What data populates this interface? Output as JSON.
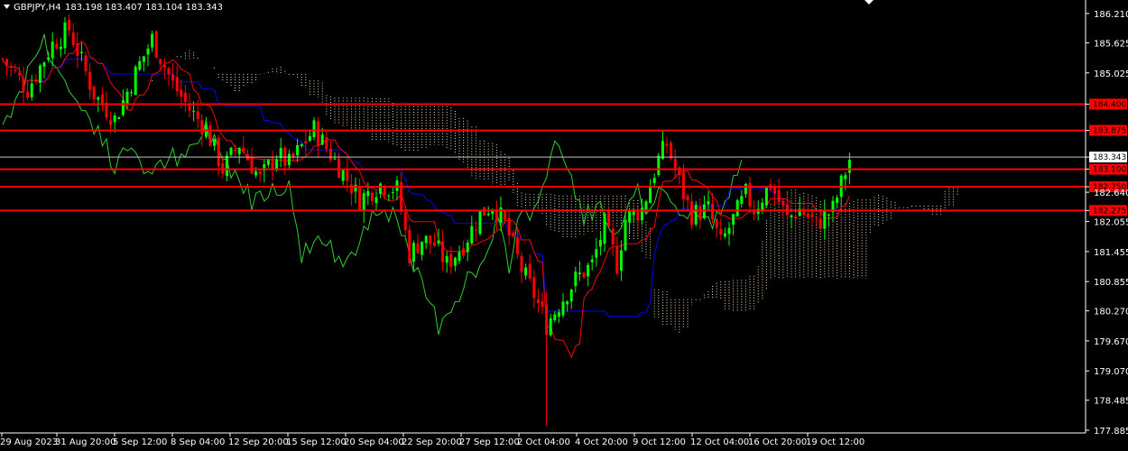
{
  "header": {
    "symbol": "GBPJPY,H4",
    "ohlc": "183.198 183.407 183.104 183.343"
  },
  "colors": {
    "background": "#000000",
    "bull_candle": "#00ff00",
    "bear_candle": "#ff0000",
    "level_line": "#ff0000",
    "kijun": "#0000ff",
    "tenkan": "#ff0000",
    "chikou": "#32cd32",
    "cloud": "#f5deb3",
    "axis": "#ffffff",
    "price_line": "#c0c0c0"
  },
  "chart_data": {
    "type": "candlestick",
    "title": "",
    "yaxis_ticks": [
      "186.210",
      "185.625",
      "185.025",
      "184.400",
      "183.875",
      "183.343",
      "183.100",
      "182.750",
      "182.640",
      "182.275",
      "182.055",
      "181.455",
      "180.855",
      "180.270",
      "179.670",
      "179.070",
      "178.485",
      "177.885"
    ],
    "ylim": [
      177.885,
      186.21
    ],
    "xaxis_ticks": [
      "29 Aug 2023",
      "31 Aug 20:00",
      "5 Sep 12:00",
      "8 Sep 04:00",
      "12 Sep 20:00",
      "15 Sep 12:00",
      "20 Sep 04:00",
      "22 Sep 20:00",
      "27 Sep 12:00",
      "2 Oct 04:00",
      "4 Oct 20:00",
      "9 Oct 12:00",
      "12 Oct 04:00",
      "16 Oct 20:00",
      "19 Oct 12:00"
    ],
    "current_price": "183.343",
    "horizontal_levels": [
      {
        "price": 184.4,
        "label": "184.400"
      },
      {
        "price": 183.875,
        "label": "183.875"
      },
      {
        "price": 183.1,
        "label": "183.100"
      },
      {
        "price": 182.75,
        "label": "182.750"
      },
      {
        "price": 182.275,
        "label": "182.275"
      }
    ],
    "close_path": [
      [
        0,
        185.3
      ],
      [
        6,
        184.7
      ],
      [
        12,
        185.6
      ],
      [
        16,
        185.9
      ],
      [
        22,
        184.6
      ],
      [
        27,
        184.1
      ],
      [
        33,
        185.2
      ],
      [
        36,
        185.7
      ],
      [
        41,
        184.8
      ],
      [
        45,
        184.3
      ],
      [
        49,
        183.9
      ],
      [
        53,
        183.1
      ],
      [
        57,
        183.6
      ],
      [
        62,
        182.9
      ],
      [
        66,
        183.4
      ],
      [
        69,
        183.2
      ],
      [
        75,
        183.9
      ],
      [
        79,
        183.4
      ],
      [
        83,
        182.9
      ],
      [
        86,
        182.5
      ],
      [
        91,
        182.8
      ],
      [
        95,
        182.7
      ],
      [
        98,
        181.4
      ],
      [
        101,
        181.7
      ],
      [
        104,
        181.6
      ],
      [
        107,
        181.2
      ],
      [
        111,
        181.6
      ],
      [
        115,
        182.2
      ],
      [
        118,
        182.4
      ],
      [
        121,
        182.0
      ],
      [
        125,
        181.1
      ],
      [
        128,
        180.6
      ],
      [
        131,
        180.0
      ],
      [
        134,
        180.4
      ],
      [
        138,
        180.9
      ],
      [
        142,
        181.2
      ],
      [
        145,
        182.0
      ],
      [
        148,
        181.2
      ],
      [
        150,
        182.1
      ],
      [
        154,
        182.3
      ],
      [
        158,
        183.3
      ],
      [
        160,
        183.6
      ],
      [
        164,
        182.6
      ],
      [
        166,
        182.2
      ],
      [
        170,
        182.3
      ],
      [
        173,
        181.6
      ],
      [
        176,
        182.1
      ],
      [
        179,
        182.6
      ],
      [
        181,
        182.3
      ],
      [
        185,
        182.8
      ],
      [
        189,
        182.1
      ],
      [
        192,
        182.3
      ],
      [
        196,
        182.0
      ],
      [
        200,
        182.3
      ],
      [
        204,
        183.3
      ]
    ],
    "bars": 205
  }
}
